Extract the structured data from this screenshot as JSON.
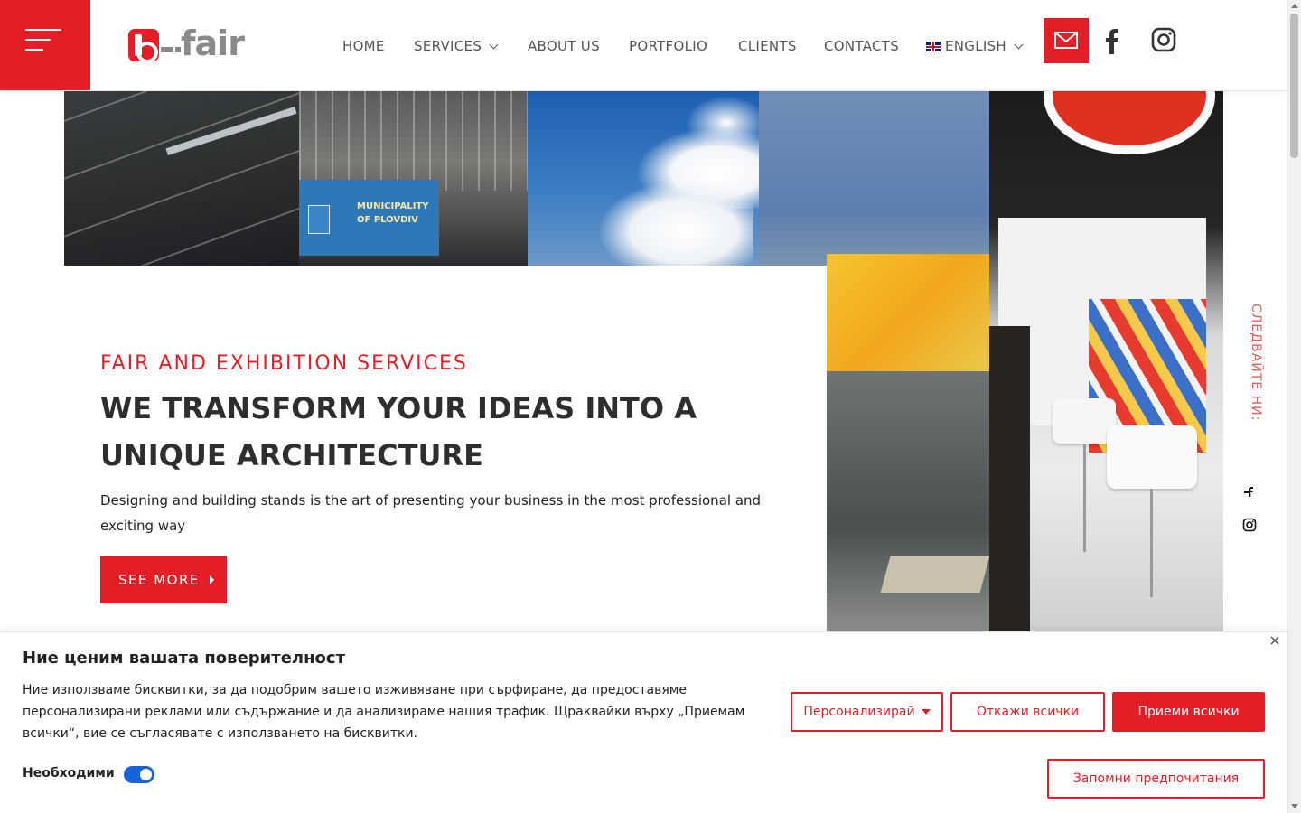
{
  "brand": {
    "logo_text": "fair",
    "accent_color": "#e31e26",
    "text_color": "#2e2e2e"
  },
  "header": {
    "menu_icon": "hamburger-icon",
    "nav": [
      {
        "label": "HOME"
      },
      {
        "label": "SERVICES",
        "has_dropdown": true
      },
      {
        "label": "ABOUT US"
      },
      {
        "label": "PORTFOLIO"
      },
      {
        "label": "CLIENTS"
      },
      {
        "label": "CONTACTS"
      },
      {
        "label": "ENGLISH",
        "has_dropdown": true,
        "icon": "uk-flag-icon"
      }
    ],
    "social": [
      {
        "icon": "mail-icon"
      },
      {
        "icon": "facebook-icon"
      },
      {
        "icon": "instagram-icon"
      }
    ]
  },
  "hero": {
    "images": {
      "municipality_sign": "MUNICIPALITY OF PLOVDIV"
    },
    "kicker": "FAIR AND EXHIBITION SERVICES",
    "title": "WE TRANSFORM YOUR IDEAS INTO A UNIQUE ARCHITECTURE",
    "description": "Designing and building stands is the art of presenting your business in the most professional and exciting way",
    "cta_label": "SEE MORE"
  },
  "side": {
    "follow_text": "СЛЕДВАЙТЕ НИ:",
    "icons": [
      "facebook-icon",
      "instagram-icon"
    ]
  },
  "cookie": {
    "title": "Ние ценим вашата поверителност",
    "text": "Ние използваме бисквитки, за да подобрим вашето изживяване при сърфиране, да предоставяме персонализирани реклами или съдържание и да анализираме нашия трафик. Щраквайки върху „Приемам всички“, вие се съгласявате с използването на бисквитки.",
    "necessary_label": "Необходими",
    "necessary_enabled": true,
    "customize_label": "Персонализирай",
    "reject_label": "Откажи всички",
    "accept_label": "Приеми всички",
    "save_label": "Запомни предпочитания"
  }
}
